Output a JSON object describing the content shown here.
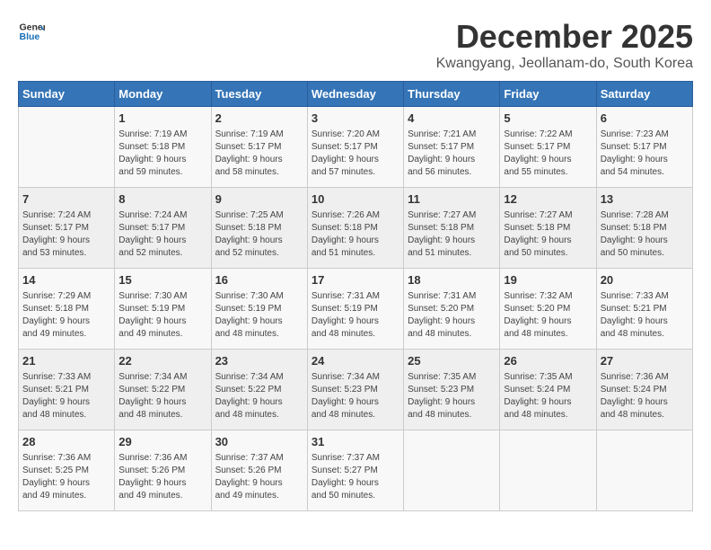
{
  "logo": {
    "line1": "General",
    "line2": "Blue"
  },
  "title": "December 2025",
  "location": "Kwangyang, Jeollanam-do, South Korea",
  "headers": [
    "Sunday",
    "Monday",
    "Tuesday",
    "Wednesday",
    "Thursday",
    "Friday",
    "Saturday"
  ],
  "weeks": [
    [
      {
        "day": "",
        "content": ""
      },
      {
        "day": "1",
        "content": "Sunrise: 7:19 AM\nSunset: 5:18 PM\nDaylight: 9 hours\nand 59 minutes."
      },
      {
        "day": "2",
        "content": "Sunrise: 7:19 AM\nSunset: 5:17 PM\nDaylight: 9 hours\nand 58 minutes."
      },
      {
        "day": "3",
        "content": "Sunrise: 7:20 AM\nSunset: 5:17 PM\nDaylight: 9 hours\nand 57 minutes."
      },
      {
        "day": "4",
        "content": "Sunrise: 7:21 AM\nSunset: 5:17 PM\nDaylight: 9 hours\nand 56 minutes."
      },
      {
        "day": "5",
        "content": "Sunrise: 7:22 AM\nSunset: 5:17 PM\nDaylight: 9 hours\nand 55 minutes."
      },
      {
        "day": "6",
        "content": "Sunrise: 7:23 AM\nSunset: 5:17 PM\nDaylight: 9 hours\nand 54 minutes."
      }
    ],
    [
      {
        "day": "7",
        "content": "Sunrise: 7:24 AM\nSunset: 5:17 PM\nDaylight: 9 hours\nand 53 minutes."
      },
      {
        "day": "8",
        "content": "Sunrise: 7:24 AM\nSunset: 5:17 PM\nDaylight: 9 hours\nand 52 minutes."
      },
      {
        "day": "9",
        "content": "Sunrise: 7:25 AM\nSunset: 5:18 PM\nDaylight: 9 hours\nand 52 minutes."
      },
      {
        "day": "10",
        "content": "Sunrise: 7:26 AM\nSunset: 5:18 PM\nDaylight: 9 hours\nand 51 minutes."
      },
      {
        "day": "11",
        "content": "Sunrise: 7:27 AM\nSunset: 5:18 PM\nDaylight: 9 hours\nand 51 minutes."
      },
      {
        "day": "12",
        "content": "Sunrise: 7:27 AM\nSunset: 5:18 PM\nDaylight: 9 hours\nand 50 minutes."
      },
      {
        "day": "13",
        "content": "Sunrise: 7:28 AM\nSunset: 5:18 PM\nDaylight: 9 hours\nand 50 minutes."
      }
    ],
    [
      {
        "day": "14",
        "content": "Sunrise: 7:29 AM\nSunset: 5:18 PM\nDaylight: 9 hours\nand 49 minutes."
      },
      {
        "day": "15",
        "content": "Sunrise: 7:30 AM\nSunset: 5:19 PM\nDaylight: 9 hours\nand 49 minutes."
      },
      {
        "day": "16",
        "content": "Sunrise: 7:30 AM\nSunset: 5:19 PM\nDaylight: 9 hours\nand 48 minutes."
      },
      {
        "day": "17",
        "content": "Sunrise: 7:31 AM\nSunset: 5:19 PM\nDaylight: 9 hours\nand 48 minutes."
      },
      {
        "day": "18",
        "content": "Sunrise: 7:31 AM\nSunset: 5:20 PM\nDaylight: 9 hours\nand 48 minutes."
      },
      {
        "day": "19",
        "content": "Sunrise: 7:32 AM\nSunset: 5:20 PM\nDaylight: 9 hours\nand 48 minutes."
      },
      {
        "day": "20",
        "content": "Sunrise: 7:33 AM\nSunset: 5:21 PM\nDaylight: 9 hours\nand 48 minutes."
      }
    ],
    [
      {
        "day": "21",
        "content": "Sunrise: 7:33 AM\nSunset: 5:21 PM\nDaylight: 9 hours\nand 48 minutes."
      },
      {
        "day": "22",
        "content": "Sunrise: 7:34 AM\nSunset: 5:22 PM\nDaylight: 9 hours\nand 48 minutes."
      },
      {
        "day": "23",
        "content": "Sunrise: 7:34 AM\nSunset: 5:22 PM\nDaylight: 9 hours\nand 48 minutes."
      },
      {
        "day": "24",
        "content": "Sunrise: 7:34 AM\nSunset: 5:23 PM\nDaylight: 9 hours\nand 48 minutes."
      },
      {
        "day": "25",
        "content": "Sunrise: 7:35 AM\nSunset: 5:23 PM\nDaylight: 9 hours\nand 48 minutes."
      },
      {
        "day": "26",
        "content": "Sunrise: 7:35 AM\nSunset: 5:24 PM\nDaylight: 9 hours\nand 48 minutes."
      },
      {
        "day": "27",
        "content": "Sunrise: 7:36 AM\nSunset: 5:24 PM\nDaylight: 9 hours\nand 48 minutes."
      }
    ],
    [
      {
        "day": "28",
        "content": "Sunrise: 7:36 AM\nSunset: 5:25 PM\nDaylight: 9 hours\nand 49 minutes."
      },
      {
        "day": "29",
        "content": "Sunrise: 7:36 AM\nSunset: 5:26 PM\nDaylight: 9 hours\nand 49 minutes."
      },
      {
        "day": "30",
        "content": "Sunrise: 7:37 AM\nSunset: 5:26 PM\nDaylight: 9 hours\nand 49 minutes."
      },
      {
        "day": "31",
        "content": "Sunrise: 7:37 AM\nSunset: 5:27 PM\nDaylight: 9 hours\nand 50 minutes."
      },
      {
        "day": "",
        "content": ""
      },
      {
        "day": "",
        "content": ""
      },
      {
        "day": "",
        "content": ""
      }
    ]
  ]
}
